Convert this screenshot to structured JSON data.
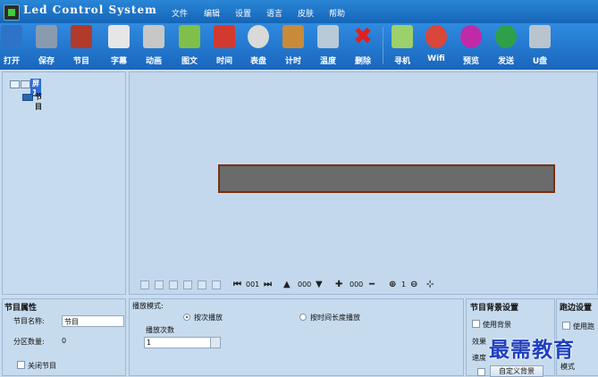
{
  "app": {
    "title": "Led Control System"
  },
  "menu": [
    "文件",
    "编辑",
    "设置",
    "语言",
    "皮肤",
    "帮助"
  ],
  "toolbar": [
    {
      "label": "打开",
      "icon": "open-folder-icon",
      "color": "#2d74c8"
    },
    {
      "label": "保存",
      "icon": "save-disk-icon",
      "color": "#8a9bb0"
    },
    {
      "label": "节目",
      "icon": "program-film-icon",
      "color": "#b13a2a"
    },
    {
      "label": "字幕",
      "icon": "subtitle-pen-icon",
      "color": "#e6e6e6"
    },
    {
      "label": "动画",
      "icon": "animation-icon",
      "color": "#c7c7c7"
    },
    {
      "label": "图文",
      "icon": "image-text-icon",
      "color": "#7fbf4a"
    },
    {
      "label": "时间",
      "icon": "time-icon",
      "color": "#d23a2f"
    },
    {
      "label": "表盘",
      "icon": "clock-dial-icon",
      "color": "#d9d9d9"
    },
    {
      "label": "计时",
      "icon": "hourglass-icon",
      "color": "#c98a3a"
    },
    {
      "label": "温度",
      "icon": "temperature-icon",
      "color": "#b8c9d8"
    },
    {
      "label": "删除",
      "icon": "delete-x-icon",
      "color": "#e02020"
    },
    {
      "label": "寻机",
      "icon": "search-device-icon",
      "color": "#9bd06a"
    },
    {
      "label": "Wifi",
      "icon": "wifi-icon",
      "color": "#d9463a"
    },
    {
      "label": "预览",
      "icon": "preview-play-icon",
      "color": "#c02aa8"
    },
    {
      "label": "发送",
      "icon": "send-globe-icon",
      "color": "#2ea04a"
    },
    {
      "label": "U盘",
      "icon": "usb-drive-icon",
      "color": "#b9c4cf"
    }
  ],
  "tree": {
    "root_label": "屏1",
    "child_label": "节目"
  },
  "controls": {
    "index": "001",
    "height": "000",
    "width": "000",
    "zoom": "1"
  },
  "props": {
    "title": "节目属性",
    "name_label": "节目名称:",
    "name_value": "节目",
    "zone_label": "分区数量:",
    "zone_value": "0",
    "close_label": "关闭节目"
  },
  "play": {
    "mode_label": "播放模式:",
    "opt1": "按次播放",
    "opt2": "按时间长度播放",
    "count_label": "播放次数",
    "count_value": "1"
  },
  "bg": {
    "title": "节目背景设置",
    "use_bg": "使用背景",
    "effect": "效果",
    "speed": "速度",
    "custom_btn": "自定义背景"
  },
  "trim": {
    "title": "跑边设置",
    "use": "使用跑",
    "mode": "模式"
  },
  "watermark": "最需教育",
  "colors": {
    "led_screen": "#6b6b6b",
    "led_border": "#7a2f0e",
    "titlebar": "#1a6fc6",
    "selection": "#2f6bd6"
  }
}
